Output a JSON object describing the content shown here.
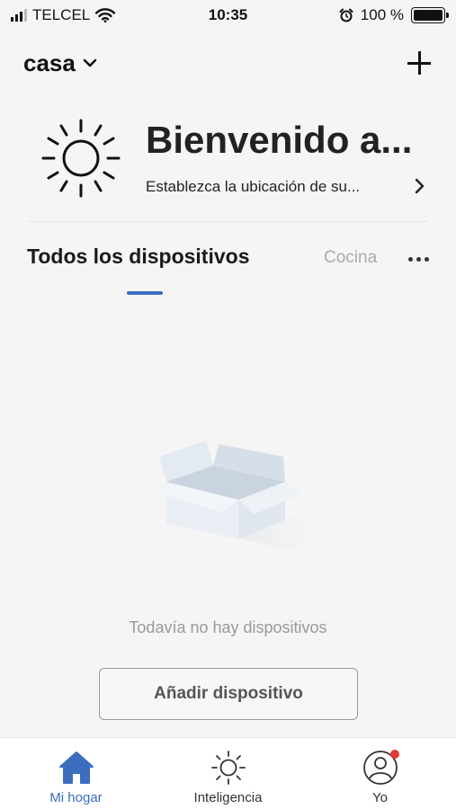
{
  "status_bar": {
    "carrier": "TELCEL",
    "time": "10:35",
    "battery": "100 %",
    "battery_level": 1.0
  },
  "header": {
    "home_name": "casa",
    "icons": {
      "dropdown": "chevron-down-icon",
      "add": "plus-icon"
    }
  },
  "welcome": {
    "title": "Bienvenido a...",
    "subtitle": "Establezca la ubicación de su...",
    "icon": "sun-icon"
  },
  "tabs": {
    "active": "Todos los dispositivos",
    "other": "Cocina",
    "more_icon": "more-horizontal-icon"
  },
  "empty_state": {
    "message": "Todavía no hay dispositivos",
    "button_label": "Añadir dispositivo",
    "illustration": "empty-box-illustration"
  },
  "bottom_nav": {
    "items": [
      {
        "label": "Mi hogar",
        "icon": "home-icon",
        "active": true
      },
      {
        "label": "Inteligencia",
        "icon": "sun-icon",
        "active": false
      },
      {
        "label": "Yo",
        "icon": "profile-icon",
        "active": false
      }
    ]
  },
  "colors": {
    "accent": "#3d6dbf",
    "badge": "#e53935",
    "background": "#f5f5f5"
  }
}
